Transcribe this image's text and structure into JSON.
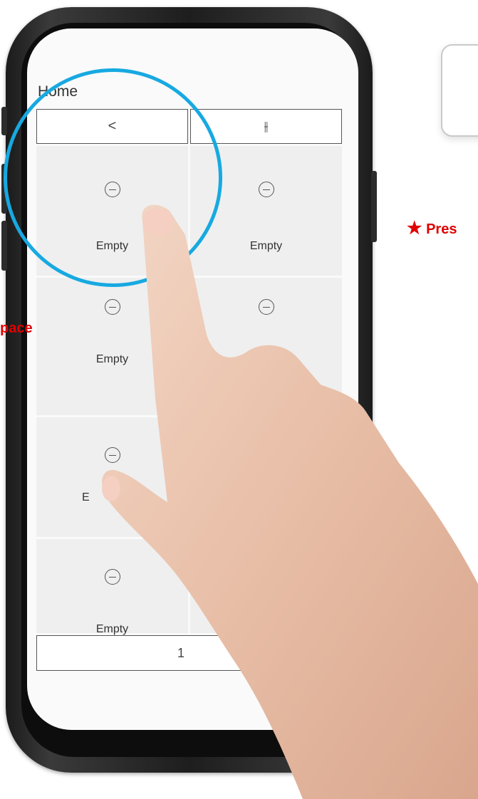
{
  "screen": {
    "title": "Home",
    "back_icon": "chevron-left-icon",
    "back_glyph": "<",
    "settings_icon": "sliders-icon",
    "settings_glyph": "⫲",
    "tiles": [
      {
        "label": "Empty",
        "icon": "minus-circle-icon"
      },
      {
        "label": "Empty",
        "icon": "minus-circle-icon"
      },
      {
        "label": "Empty",
        "icon": "minus-circle-icon"
      },
      {
        "label": "",
        "icon": "minus-circle-icon"
      },
      {
        "label": "E",
        "icon": "minus-circle-icon"
      },
      {
        "label": "",
        "icon": "minus-circle-icon"
      },
      {
        "label": "Empty",
        "icon": "minus-circle-icon"
      },
      {
        "label": "",
        "icon": "minus-circle-icon"
      }
    ],
    "bottom_hint": "Empty",
    "bottom_glyph": "1"
  },
  "annotations": {
    "left_note": "pace",
    "right_note_star": "★",
    "right_note": "Pres",
    "highlight_color": "#17a9e1",
    "note_color": "#e00000"
  }
}
